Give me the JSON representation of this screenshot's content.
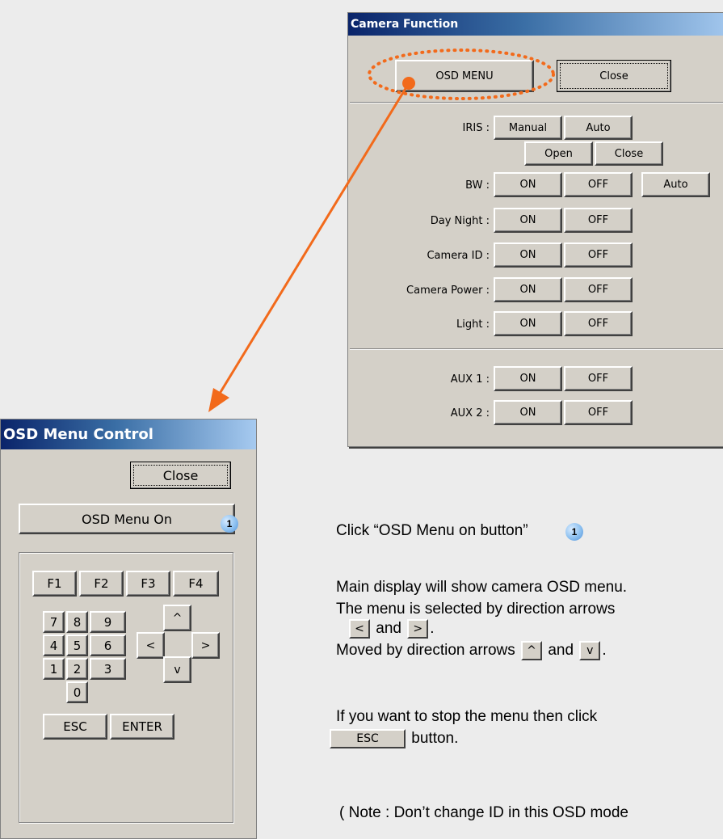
{
  "camera_function": {
    "title": "Camera Function",
    "osd_menu_label": "OSD MENU",
    "close_label": "Close",
    "rows": [
      {
        "label": "IRIS :",
        "buttons": [
          "Manual",
          "Auto"
        ]
      },
      {
        "label": "",
        "buttons": [
          "Open",
          "Close"
        ]
      },
      {
        "label": "BW :",
        "buttons": [
          "ON",
          "OFF",
          "Auto"
        ]
      },
      {
        "label": "Day Night :",
        "buttons": [
          "ON",
          "OFF"
        ]
      },
      {
        "label": "Camera ID :",
        "buttons": [
          "ON",
          "OFF"
        ]
      },
      {
        "label": "Camera Power :",
        "buttons": [
          "ON",
          "OFF"
        ]
      },
      {
        "label": "Light :",
        "buttons": [
          "ON",
          "OFF"
        ]
      },
      {
        "label": "AUX 1 :",
        "buttons": [
          "ON",
          "OFF"
        ]
      },
      {
        "label": "AUX 2 :",
        "buttons": [
          "ON",
          "OFF"
        ]
      }
    ]
  },
  "osd_menu_control": {
    "title": "OSD Menu Control",
    "close_label": "Close",
    "osd_menu_on_label": "OSD Menu On",
    "fkeys": [
      "F1",
      "F2",
      "F3",
      "F4"
    ],
    "numpad": [
      "7",
      "8",
      "9",
      "4",
      "5",
      "6",
      "1",
      "2",
      "3",
      "0"
    ],
    "arrows": {
      "up": "^",
      "left": "<",
      "right": ">",
      "down": "v"
    },
    "esc_label": "ESC",
    "enter_label": "ENTER"
  },
  "badge_number": "1",
  "instructions": {
    "step1_prefix": "Click “OSD Menu on button”",
    "line_main_display": "Main display will show camera OSD menu.",
    "line_selected_by": "The menu is selected by direction arrows",
    "left_arrow": "<",
    "and_1": "and",
    "right_arrow": ">",
    "period_1": ".",
    "line_moved_by": "Moved by direction arrows",
    "up_arrow": "^",
    "and_2": "and",
    "down_arrow": "v",
    "period_2": ".",
    "line_stop": "If you want to stop the menu then click",
    "esc_button": "ESC",
    "button_word": "button.",
    "note": "(   Note : Don’t change ID in this OSD mode"
  },
  "colors": {
    "arrow": "#f26a1b",
    "dialog_bg": "#d4d0c8"
  }
}
